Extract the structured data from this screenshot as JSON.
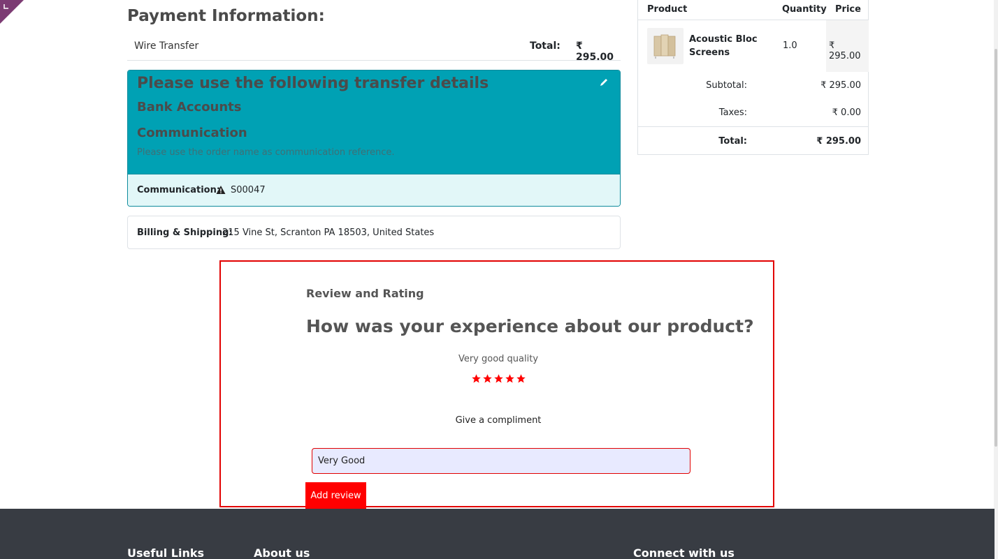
{
  "payment": {
    "title": "Payment Information:",
    "method": "Wire Transfer",
    "total_label": "Total:",
    "total_value": "₹ 295.00"
  },
  "transfer": {
    "heading": "Please use the following transfer details",
    "bank_accounts": "Bank Accounts",
    "communication_heading": "Communication",
    "note": "Please use the order name as communication reference.",
    "communication_label": "Communication:",
    "reference": "S00047",
    "icons": {
      "edit": "pencil-icon",
      "warning": "warning-icon"
    }
  },
  "billing": {
    "label": "Billing & Shipping:",
    "address": "215 Vine St, Scranton PA 18503, United States"
  },
  "order_summary": {
    "headers": {
      "product": "Product",
      "quantity": "Quantity",
      "price": "Price"
    },
    "items": [
      {
        "name": "Acoustic Bloc Screens",
        "quantity": "1.0",
        "price": "₹ 295.00"
      }
    ],
    "subtotal_label": "Subtotal:",
    "subtotal_value": "₹ 295.00",
    "taxes_label": "Taxes:",
    "taxes_value": "₹ 0.00",
    "total_label": "Total:",
    "total_value": "₹ 295.00"
  },
  "review": {
    "section_title": "Review and Rating",
    "question": "How was your experience about our product?",
    "rating_text": "Very good quality",
    "rating": 5,
    "rating_max": 5,
    "compliment_label": "Give a compliment",
    "input_value": "Very Good",
    "submit_label": "Add review",
    "star_color": "#ff0000"
  },
  "footer": {
    "useful_links": "Useful Links",
    "about_us": "About us",
    "connect": "Connect with us"
  },
  "colors": {
    "transfer_bg": "#00a1b4",
    "transfer_light": "#e2f7f8",
    "accent_red": "#ff0000",
    "footer_bg": "#383c43"
  }
}
